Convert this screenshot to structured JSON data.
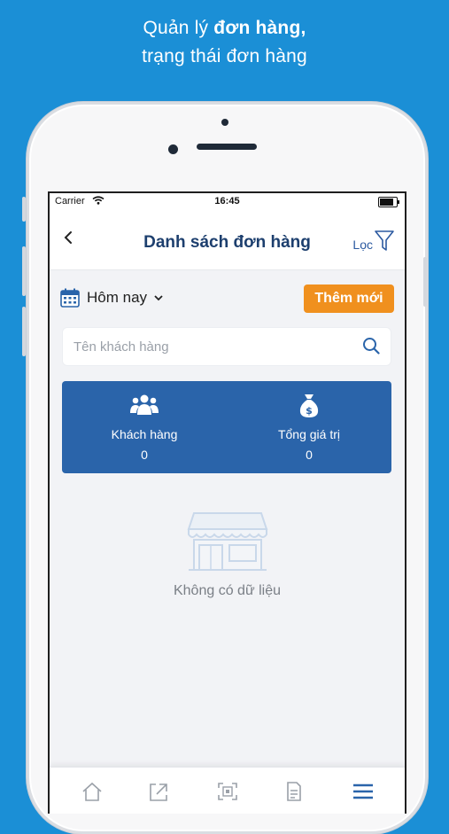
{
  "promo": {
    "line1_prefix": "Quản lý ",
    "line1_bold": "đơn hàng,",
    "line2": "trạng thái đơn hàng"
  },
  "status_bar": {
    "carrier": "Carrier",
    "time": "16:45",
    "battery_level": 0.95
  },
  "nav": {
    "title": "Danh sách đơn hàng",
    "filter_label": "Lọc"
  },
  "date_filter": {
    "label": "Hôm nay"
  },
  "actions": {
    "add_label": "Thêm mới"
  },
  "search": {
    "placeholder": "Tên khách hàng"
  },
  "summary": {
    "customers_label": "Khách hàng",
    "customers_value": "0",
    "total_label": "Tổng giá trị",
    "total_value": "0"
  },
  "empty_state": {
    "text": "Không có dữ liệu"
  },
  "icons": [
    "calendar-icon",
    "search-icon",
    "users-icon",
    "money-bag-icon",
    "filter-icon",
    "store-icon",
    "home-icon",
    "share-icon",
    "qr-icon",
    "document-icon",
    "menu-icon"
  ],
  "colors": {
    "background": "#1b8fd6",
    "title": "#1d3f6e",
    "accent_orange": "#f0901e",
    "summary_blue": "#2a64aa"
  }
}
